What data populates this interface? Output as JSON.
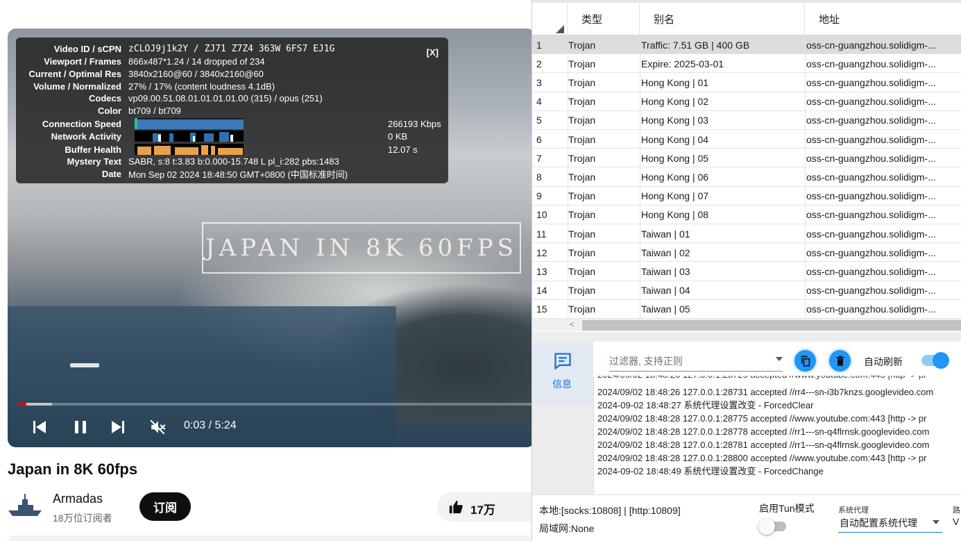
{
  "stats": {
    "close": "[X]",
    "rows": [
      {
        "label": "Video ID / sCPN",
        "value": "zCLOJ9j1k2Y / ZJ71 Z7Z4 363W 6FS7 EJ1G"
      },
      {
        "label": "Viewport / Frames",
        "value": "866x487*1.24 / 14 dropped of 234"
      },
      {
        "label": "Current / Optimal Res",
        "value": "3840x2160@60 / 3840x2160@60"
      },
      {
        "label": "Volume / Normalized",
        "value": "27% / 17% (content loudness 4.1dB)"
      },
      {
        "label": "Codecs",
        "value": "vp09.00.51.08.01.01.01.01.00 (315) / opus (251)"
      },
      {
        "label": "Color",
        "value": "bt709 / bt709"
      },
      {
        "label": "Connection Speed",
        "value": "266193 Kbps"
      },
      {
        "label": "Network Activity",
        "value": "0 KB"
      },
      {
        "label": "Buffer Health",
        "value": "12.07 s"
      },
      {
        "label": "Mystery Text",
        "value": "SABR, s:8 t:3.83 b:0.000-15.748 L pl_i:282 pbs:1483"
      },
      {
        "label": "Date",
        "value": "Mon Sep 02 2024 18:48:50 GMT+0800 (中国标准时间)"
      }
    ]
  },
  "player": {
    "watermark": "JAPAN IN 8K 60FPS",
    "time": "0:03 / 5:24",
    "progress_played": 0.017,
    "progress_buffered": 0.067
  },
  "video": {
    "title": "Japan in 8K 60fps",
    "channel": "Armadas",
    "subscribers": "18万位订阅者",
    "subscribe_label": "订阅",
    "likes": "17万"
  },
  "v2": {
    "columns": [
      "类型",
      "别名",
      "地址"
    ],
    "rows": [
      {
        "idx": "1",
        "type": "Trojan",
        "alias": "Traffic: 7.51 GB | 400 GB",
        "addr": "oss-cn-guangzhou.solidigm-..."
      },
      {
        "idx": "2",
        "type": "Trojan",
        "alias": "Expire: 2025-03-01",
        "addr": "oss-cn-guangzhou.solidigm-..."
      },
      {
        "idx": "3",
        "type": "Trojan",
        "alias": "Hong Kong | 01",
        "addr": "oss-cn-guangzhou.solidigm-..."
      },
      {
        "idx": "4",
        "type": "Trojan",
        "alias": "Hong Kong | 02",
        "addr": "oss-cn-guangzhou.solidigm-..."
      },
      {
        "idx": "5",
        "type": "Trojan",
        "alias": "Hong Kong | 03",
        "addr": "oss-cn-guangzhou.solidigm-..."
      },
      {
        "idx": "6",
        "type": "Trojan",
        "alias": "Hong Kong | 04",
        "addr": "oss-cn-guangzhou.solidigm-..."
      },
      {
        "idx": "7",
        "type": "Trojan",
        "alias": "Hong Kong | 05",
        "addr": "oss-cn-guangzhou.solidigm-..."
      },
      {
        "idx": "8",
        "type": "Trojan",
        "alias": "Hong Kong | 06",
        "addr": "oss-cn-guangzhou.solidigm-..."
      },
      {
        "idx": "9",
        "type": "Trojan",
        "alias": "Hong Kong | 07",
        "addr": "oss-cn-guangzhou.solidigm-..."
      },
      {
        "idx": "10",
        "type": "Trojan",
        "alias": "Hong Kong | 08",
        "addr": "oss-cn-guangzhou.solidigm-..."
      },
      {
        "idx": "11",
        "type": "Trojan",
        "alias": "Taiwan | 01",
        "addr": "oss-cn-guangzhou.solidigm-..."
      },
      {
        "idx": "12",
        "type": "Trojan",
        "alias": "Taiwan | 02",
        "addr": "oss-cn-guangzhou.solidigm-..."
      },
      {
        "idx": "13",
        "type": "Trojan",
        "alias": "Taiwan | 03",
        "addr": "oss-cn-guangzhou.solidigm-..."
      },
      {
        "idx": "14",
        "type": "Trojan",
        "alias": "Taiwan | 04",
        "addr": "oss-cn-guangzhou.solidigm-..."
      },
      {
        "idx": "15",
        "type": "Trojan",
        "alias": "Taiwan | 05",
        "addr": "oss-cn-guangzhou.solidigm-..."
      }
    ],
    "nav_info": "信息",
    "filter_placeholder": "过滤器, 支持正则",
    "auto_refresh": "自动刷新",
    "log": [
      "2024/09/02 18:48:26 127.0.0.1:28731 accepted //rr4---sn-i3b7knzs.googlevideo.com",
      "2024-09-02 18:48:27 系统代理设置改变 - ForcedClear",
      "2024/09/02 18:48:28 127.0.0.1:28775 accepted //www.youtube.com:443 [http -> pr",
      "2024/09/02 18:48:28 127.0.0.1:28778 accepted //rr1---sn-q4flrnsk.googlevideo.com",
      "2024/09/02 18:48:28 127.0.0.1:28781 accepted //rr1---sn-q4flrnsk.googlevideo.com",
      "2024/09/02 18:48:28 127.0.0.1:28800 accepted //www.youtube.com:443 [http -> pr",
      "2024-09-02 18:48:49 系统代理设置改变 - ForcedChange"
    ],
    "local_ports": "本地:[socks:10808] | [http:10809]",
    "lan": "局域网:None",
    "tun_label": "启用Tun模式",
    "sysproxy_label": "系统代理",
    "sysproxy_value": "自动配置系统代理",
    "route_label_cut": "路",
    "route_value_cut": "V"
  },
  "colors": {
    "accent": "#2196f3",
    "progress": "#ff0000",
    "selected_row": "#dcdcdc"
  }
}
